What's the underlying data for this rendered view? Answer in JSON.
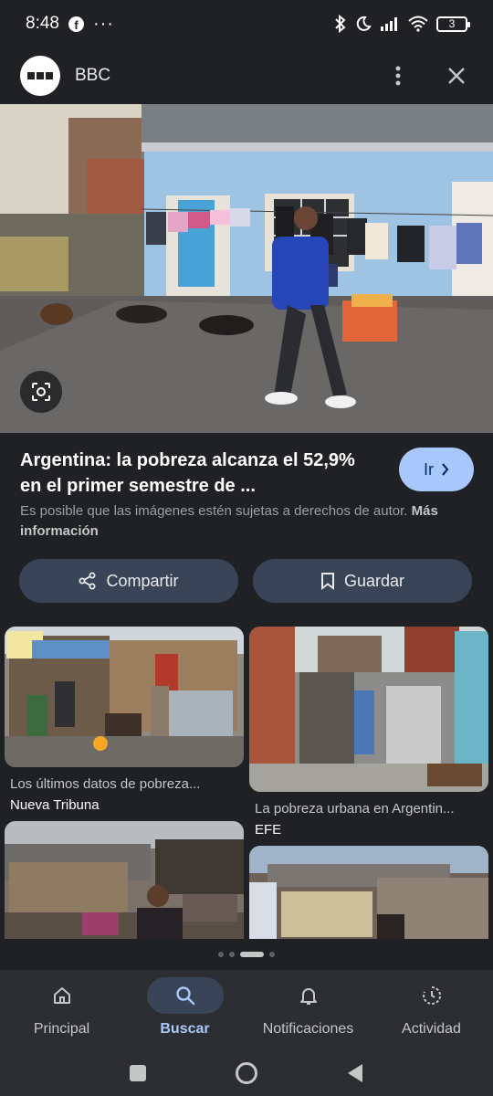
{
  "status_bar": {
    "time": "8:48",
    "battery": "3"
  },
  "header": {
    "source": "BBC"
  },
  "result": {
    "title": "Argentina: la pobreza alcanza el 52,9% en el primer semestre de ...",
    "go_label": "Ir",
    "copyright": "Es posible que las imágenes estén sujetas a derechos de autor.",
    "more_info": "Más información"
  },
  "actions": {
    "share": "Compartir",
    "save": "Guardar"
  },
  "related": [
    {
      "caption": "Los últimos datos de pobreza...",
      "source": "Nueva Tribuna"
    },
    {
      "caption": "La pobreza urbana en Argentin...",
      "source": "EFE"
    },
    {
      "caption": "",
      "source": ""
    },
    {
      "caption": "",
      "source": ""
    }
  ],
  "bottom_nav": [
    {
      "label": "Principal",
      "icon": "home-icon"
    },
    {
      "label": "Buscar",
      "icon": "search-icon",
      "active": true
    },
    {
      "label": "Notificaciones",
      "icon": "bell-icon"
    },
    {
      "label": "Actividad",
      "icon": "activity-icon"
    }
  ],
  "colors": {
    "accent": "#a8c7fa",
    "background": "#202124",
    "button": "#394457"
  }
}
